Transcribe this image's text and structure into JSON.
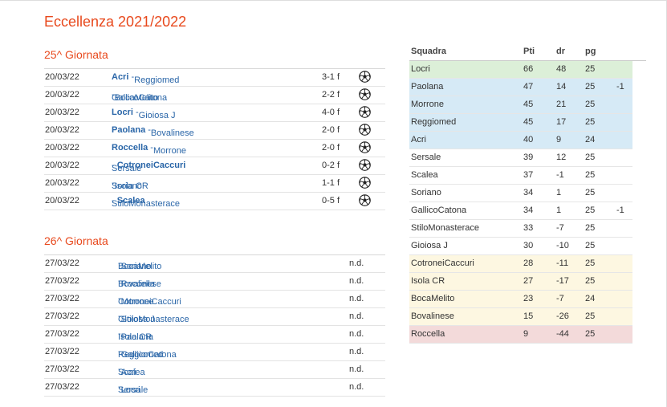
{
  "title": "Eccellenza 2021/2022",
  "round25": {
    "heading": "25^ Giornata",
    "matches": [
      {
        "date": "20/03/22",
        "home": "Acri",
        "away": "Reggiomed",
        "winner": "home",
        "score": "3-1 f"
      },
      {
        "date": "20/03/22",
        "home": "GallicoCatona",
        "away": "BocaMelito",
        "winner": "none",
        "score": "2-2 f"
      },
      {
        "date": "20/03/22",
        "home": "Locri",
        "away": "Gioiosa J",
        "winner": "home",
        "score": "4-0 f"
      },
      {
        "date": "20/03/22",
        "home": "Paolana",
        "away": "Bovalinese",
        "winner": "home",
        "score": "2-0 f"
      },
      {
        "date": "20/03/22",
        "home": "Roccella",
        "away": "Morrone",
        "winner": "home",
        "score": "2-0 f"
      },
      {
        "date": "20/03/22",
        "home": "Sersale",
        "away": "CotroneiCaccuri",
        "winner": "away",
        "score": "0-2 f"
      },
      {
        "date": "20/03/22",
        "home": "Soriano",
        "away": "Isola CR",
        "winner": "none",
        "score": "1-1 f"
      },
      {
        "date": "20/03/22",
        "home": "StiloMonasterace",
        "away": "Scalea",
        "winner": "away",
        "score": "0-5 f"
      }
    ]
  },
  "round26": {
    "heading": "26^ Giornata",
    "matches": [
      {
        "date": "27/03/22",
        "home": "BocaMelito",
        "away": "Soriano",
        "score": "n.d."
      },
      {
        "date": "27/03/22",
        "home": "Bovalinese",
        "away": "Roccella",
        "score": "n.d."
      },
      {
        "date": "27/03/22",
        "home": "CotroneiCaccuri",
        "away": "Morrone",
        "score": "n.d."
      },
      {
        "date": "27/03/22",
        "home": "Gioiosa J",
        "away": "StiloMonasterace",
        "score": "n.d."
      },
      {
        "date": "27/03/22",
        "home": "Isola CR",
        "away": "Paolana",
        "score": "n.d."
      },
      {
        "date": "27/03/22",
        "home": "Reggiomed",
        "away": "GallicoCatona",
        "score": "n.d."
      },
      {
        "date": "27/03/22",
        "home": "Scalea",
        "away": "Acri",
        "score": "n.d."
      },
      {
        "date": "27/03/22",
        "home": "Sersale",
        "away": "Locri",
        "score": "n.d."
      }
    ]
  },
  "standings": {
    "headers": {
      "team": "Squadra",
      "pti": "Pti",
      "dr": "dr",
      "pg": "pg"
    },
    "rows": [
      {
        "team": "Locri",
        "pti": "66",
        "dr": "48",
        "pg": "25",
        "pen": "",
        "zone": "green"
      },
      {
        "team": "Paolana",
        "pti": "47",
        "dr": "14",
        "pg": "25",
        "pen": "-1",
        "zone": "blue"
      },
      {
        "team": "Morrone",
        "pti": "45",
        "dr": "21",
        "pg": "25",
        "pen": "",
        "zone": "blue"
      },
      {
        "team": "Reggiomed",
        "pti": "45",
        "dr": "17",
        "pg": "25",
        "pen": "",
        "zone": "blue"
      },
      {
        "team": "Acri",
        "pti": "40",
        "dr": "9",
        "pg": "24",
        "pen": "",
        "zone": "blue"
      },
      {
        "team": "Sersale",
        "pti": "39",
        "dr": "12",
        "pg": "25",
        "pen": "",
        "zone": "none"
      },
      {
        "team": "Scalea",
        "pti": "37",
        "dr": "-1",
        "pg": "25",
        "pen": "",
        "zone": "none"
      },
      {
        "team": "Soriano",
        "pti": "34",
        "dr": "1",
        "pg": "25",
        "pen": "",
        "zone": "none"
      },
      {
        "team": "GallicoCatona",
        "pti": "34",
        "dr": "1",
        "pg": "25",
        "pen": "-1",
        "zone": "none"
      },
      {
        "team": "StiloMonasterace",
        "pti": "33",
        "dr": "-7",
        "pg": "25",
        "pen": "",
        "zone": "none"
      },
      {
        "team": "Gioiosa J",
        "pti": "30",
        "dr": "-10",
        "pg": "25",
        "pen": "",
        "zone": "none"
      },
      {
        "team": "CotroneiCaccuri",
        "pti": "28",
        "dr": "-11",
        "pg": "25",
        "pen": "",
        "zone": "yellow"
      },
      {
        "team": "Isola CR",
        "pti": "27",
        "dr": "-17",
        "pg": "25",
        "pen": "",
        "zone": "yellow"
      },
      {
        "team": "BocaMelito",
        "pti": "23",
        "dr": "-7",
        "pg": "24",
        "pen": "",
        "zone": "yellow"
      },
      {
        "team": "Bovalinese",
        "pti": "15",
        "dr": "-26",
        "pg": "25",
        "pen": "",
        "zone": "yellow"
      },
      {
        "team": "Roccella",
        "pti": "9",
        "dr": "-44",
        "pg": "25",
        "pen": "",
        "zone": "red"
      }
    ]
  }
}
